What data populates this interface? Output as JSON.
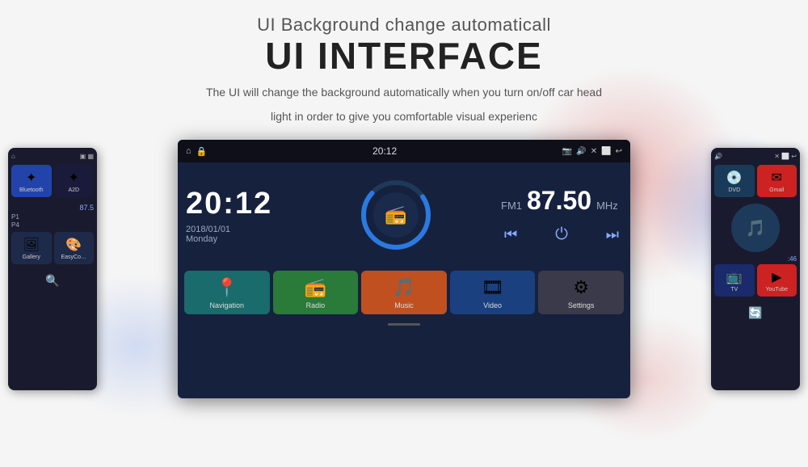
{
  "header": {
    "title": "UI Background change automaticall",
    "large_title": "UI INTERFACE",
    "description_line1": "The UI will change the background automatically when you turn on/off car head",
    "description_line2": "light in order to give you comfortable visual experienc"
  },
  "main_screen": {
    "status_bar": {
      "home_icon": "⌂",
      "lock_icon": "🔒",
      "time": "20:12",
      "camera_icon": "📷",
      "volume_icon": "🔊",
      "close_icon": "✕",
      "screen_icon": "⬛",
      "back_icon": "↩"
    },
    "clock": {
      "time": "20:12",
      "date": "2018/01/01",
      "day": "Monday"
    },
    "radio": {
      "label": "FM1",
      "frequency": "87.50",
      "unit": "MHz"
    },
    "apps": [
      {
        "label": "Navigation",
        "icon": "📍",
        "color": "teal"
      },
      {
        "label": "Radio",
        "icon": "📻",
        "color": "green"
      },
      {
        "label": "Music",
        "icon": "🎵",
        "color": "orange"
      },
      {
        "label": "Video",
        "icon": "🎞",
        "color": "blue"
      },
      {
        "label": "Settings",
        "icon": "⚙",
        "color": "gray"
      }
    ]
  },
  "left_screen": {
    "apps": [
      {
        "label": "Bluetooth",
        "icon": "✦",
        "color": "blue"
      },
      {
        "label": "A2D",
        "icon": "✦",
        "color": "dark"
      }
    ],
    "bottom_apps": [
      {
        "label": "Gallery",
        "icon": "🖼"
      },
      {
        "label": "EasyCo…",
        "icon": "🎨"
      }
    ],
    "fm_text": "87.5",
    "p1": "P1",
    "p4": "P4"
  },
  "right_screen": {
    "apps": [
      {
        "label": "DVD",
        "icon": "💿",
        "color": "dark"
      },
      {
        "label": "Gmail",
        "icon": "✉",
        "color": "red"
      }
    ],
    "bottom_apps": [
      {
        "label": "TV",
        "icon": "📺"
      },
      {
        "label": "YouTube",
        "icon": "▶",
        "color": "red"
      }
    ],
    "time_label": "46"
  }
}
